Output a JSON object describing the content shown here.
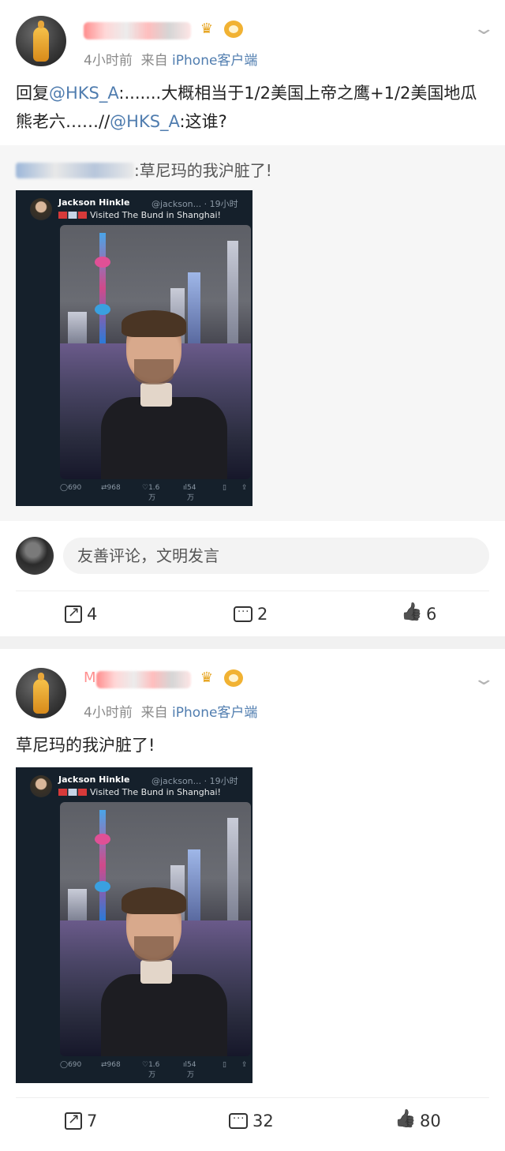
{
  "posts": [
    {
      "meta_time": "4小时前",
      "meta_from": "来自",
      "meta_source": "iPhone客户端",
      "text_prefix": "回复",
      "mention1": "@HKS_A",
      "text_main": ":.......大概相当于1/2美国上帝之鹰+1/2美国地瓜熊老六……//",
      "mention2": "@HKS_A",
      "text_end": ":这谁?",
      "quote_text": ":草尼玛的我沪脏了!",
      "comment_placeholder": "友善评论，文明发言",
      "share_count": "4",
      "comment_count": "2",
      "like_count": "6"
    },
    {
      "name_partial": "M",
      "meta_time": "4小时前",
      "meta_from": "来自",
      "meta_source": "iPhone客户端",
      "text": "草尼玛的我沪脏了!",
      "share_count": "7",
      "comment_count": "32",
      "like_count": "80"
    }
  ],
  "tweet": {
    "author": "Jackson Hinkle",
    "handle": "@jackson... · 19小时",
    "body": "Visited The Bund in Shanghai!",
    "stats": {
      "replies": "690",
      "retweets": "968",
      "likes": "1.6万",
      "views": "54万"
    }
  },
  "icons": {
    "more": "chevron-down-icon",
    "share": "share-icon",
    "comment": "comment-icon",
    "like": "thumbs-up-icon"
  },
  "colors": {
    "link": "#507daf",
    "meta": "#8a8a8a",
    "tweet_bg": "#15202b"
  }
}
